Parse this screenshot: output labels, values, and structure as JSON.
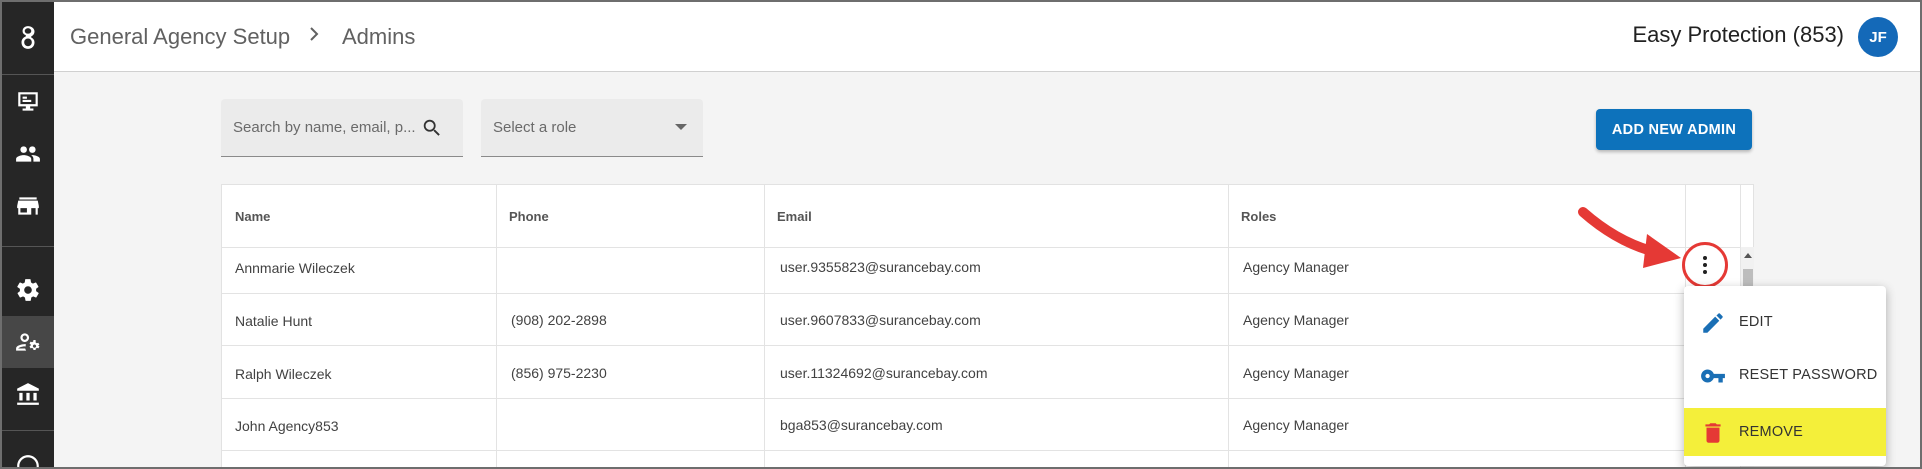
{
  "sidebar": {
    "items": [
      {
        "icon": "logo-icon"
      },
      {
        "icon": "monitor-icon"
      },
      {
        "icon": "people-icon"
      },
      {
        "icon": "storefront-icon"
      },
      {
        "icon": "gear-icon"
      },
      {
        "icon": "user-settings-icon"
      },
      {
        "icon": "bank-icon"
      },
      {
        "icon": "circle-icon"
      }
    ],
    "active_index": 5
  },
  "header": {
    "breadcrumb": [
      "General Agency Setup",
      "Admins"
    ],
    "company": "Easy Protection (853)",
    "avatar_initials": "JF",
    "avatar_color": "#1469b8"
  },
  "filters": {
    "search_placeholder": "Search by name, email, p...",
    "role_placeholder": "Select a role"
  },
  "add_button_label": "ADD NEW ADMIN",
  "accent_color": "#0d72bb",
  "table": {
    "columns": [
      "Name",
      "Phone",
      "Email",
      "Roles"
    ],
    "rows": [
      {
        "name": "Annmarie Wileczek",
        "phone": "",
        "email": "user.9355823@surancebay.com",
        "role": "Agency Manager"
      },
      {
        "name": "Natalie Hunt",
        "phone": "(908) 202-2898",
        "email": "user.9607833@surancebay.com",
        "role": "Agency Manager"
      },
      {
        "name": "Ralph Wileczek",
        "phone": "(856) 975-2230",
        "email": "user.11324692@surancebay.com",
        "role": "Agency Manager"
      },
      {
        "name": "John Agency853",
        "phone": "",
        "email": "bga853@surancebay.com",
        "role": "Agency Manager"
      }
    ]
  },
  "row_menu": {
    "items": [
      {
        "label": "EDIT",
        "icon": "pencil-icon"
      },
      {
        "label": "RESET PASSWORD",
        "icon": "key-icon"
      },
      {
        "label": "REMOVE",
        "icon": "trash-icon",
        "highlighted": true
      }
    ]
  },
  "annotation_color": "#e53935"
}
